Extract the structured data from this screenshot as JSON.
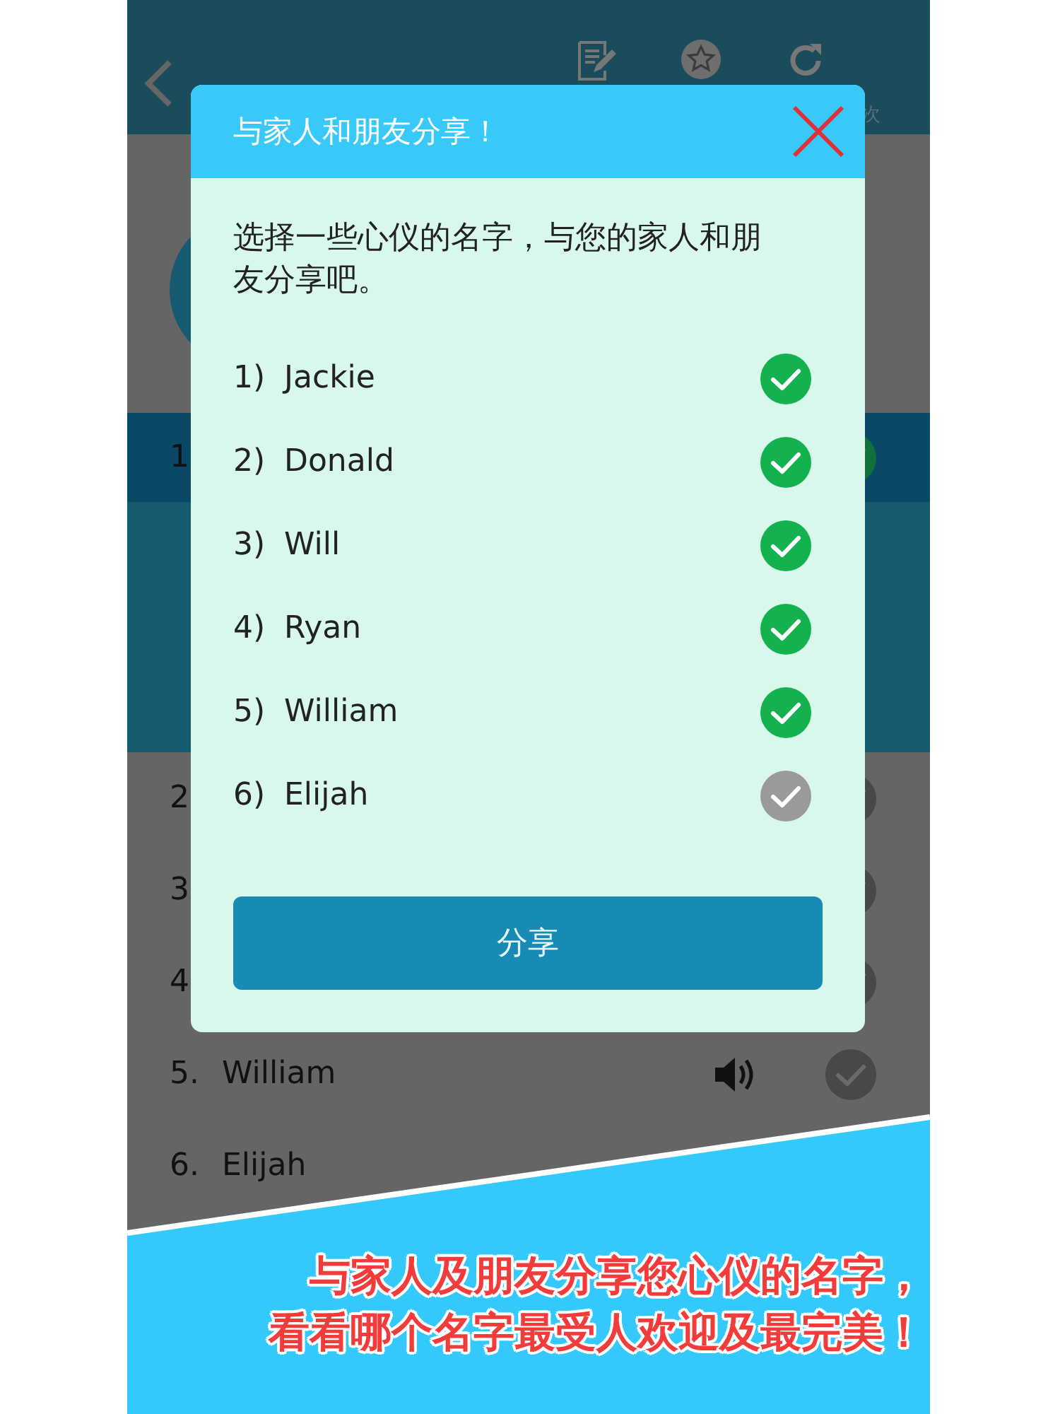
{
  "header": {
    "refresh_label": "次"
  },
  "rows": [
    {
      "number": "1",
      "selected": true,
      "checked": true,
      "speaker": false
    },
    {
      "number": "2",
      "selected": false,
      "checked": false,
      "speaker": false
    },
    {
      "number": "3",
      "selected": false,
      "checked": false,
      "speaker": false
    },
    {
      "number": "4",
      "selected": false,
      "checked": false,
      "speaker": false
    },
    {
      "number": "5.",
      "name": "William",
      "selected": false,
      "checked": false,
      "speaker": true
    },
    {
      "number": "6.",
      "name": "Elijah",
      "selected": false,
      "speaker": false
    }
  ],
  "dialog": {
    "title": "与家人和朋友分享！",
    "description": "选择一些心仪的名字，与您的家人和朋友分享吧。",
    "items": [
      {
        "number": "1)",
        "name": "Jackie",
        "checked": true
      },
      {
        "number": "2)",
        "name": "Donald",
        "checked": true
      },
      {
        "number": "3)",
        "name": "Will",
        "checked": true
      },
      {
        "number": "4)",
        "name": "Ryan",
        "checked": true
      },
      {
        "number": "5)",
        "name": "William",
        "checked": true
      },
      {
        "number": "6)",
        "name": "Elijah",
        "checked": false
      }
    ],
    "button": "分享"
  },
  "banner": {
    "lines": [
      "与家人及朋友分享您心仪的名字，",
      "看看哪个名字最受人欢迎及最完美！"
    ]
  }
}
